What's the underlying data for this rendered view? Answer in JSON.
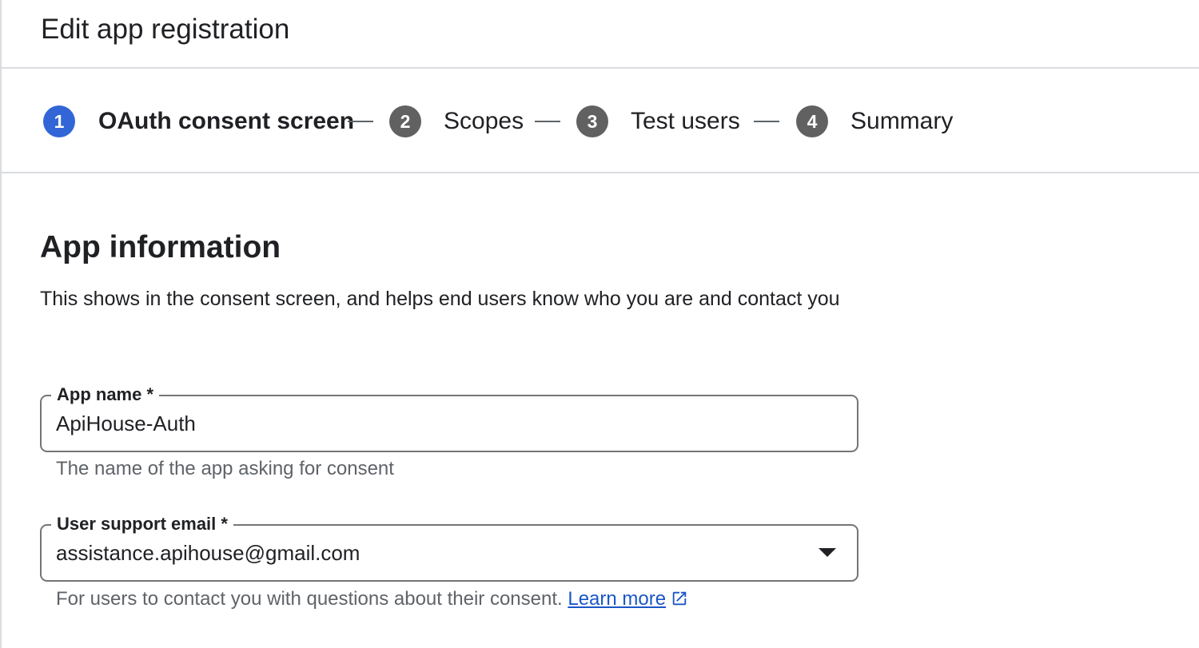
{
  "header": {
    "title": "Edit app registration"
  },
  "stepper": {
    "steps": [
      {
        "number": "1",
        "label": "OAuth consent screen",
        "active": true
      },
      {
        "number": "2",
        "label": "Scopes",
        "active": false
      },
      {
        "number": "3",
        "label": "Test users",
        "active": false
      },
      {
        "number": "4",
        "label": "Summary",
        "active": false
      }
    ]
  },
  "main": {
    "section_title": "App information",
    "description": "This shows in the consent screen, and helps end users know who you are and contact you",
    "app_name": {
      "label": "App name *",
      "value": "ApiHouse-Auth",
      "helper": "The name of the app asking for consent"
    },
    "support_email": {
      "label": "User support email *",
      "value": "assistance.apihouse@gmail.com",
      "helper": "For users to contact you with questions about their consent.",
      "learn_more": "Learn more"
    }
  },
  "colors": {
    "active_step": "#3266d6",
    "inactive_step": "#616161",
    "link": "#1a56c7",
    "border": "#757575"
  }
}
